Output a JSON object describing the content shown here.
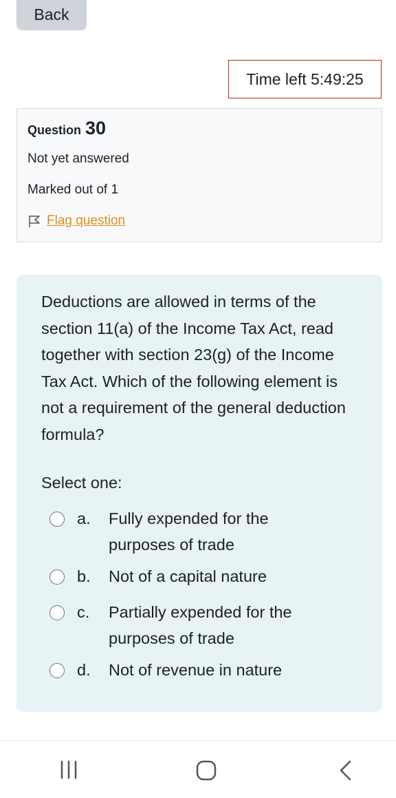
{
  "header": {
    "back_label": "Back",
    "timer_text": "Time left 5:49:25"
  },
  "question_info": {
    "label": "Question",
    "number": "30",
    "state": "Not yet answered",
    "grade": "Marked out of 1",
    "flag_label": "Flag question"
  },
  "question": {
    "text": "Deductions are allowed in terms of the section 11(a) of the Income Tax Act, read together with section 23(g) of the Income Tax Act. Which of the following element is not a requirement of the general deduction formula?",
    "prompt": "Select one:",
    "options": [
      {
        "letter": "a.",
        "text": "Fully expended for the purposes of trade"
      },
      {
        "letter": "b.",
        "text": "Not of a capital nature"
      },
      {
        "letter": "c.",
        "text": "Partially expended for the purposes of trade"
      },
      {
        "letter": "d.",
        "text": "Not of revenue in nature"
      }
    ]
  },
  "nav": {
    "recent_icon": "recent-apps-icon",
    "home_icon": "home-icon",
    "back_icon": "back-chevron-icon"
  },
  "colors": {
    "accent_link": "#e08f1b",
    "timer_border": "#b02a1b",
    "question_bg": "#e7f3f5",
    "info_bg": "#f8f9fa",
    "back_button_bg": "#ced4da"
  }
}
